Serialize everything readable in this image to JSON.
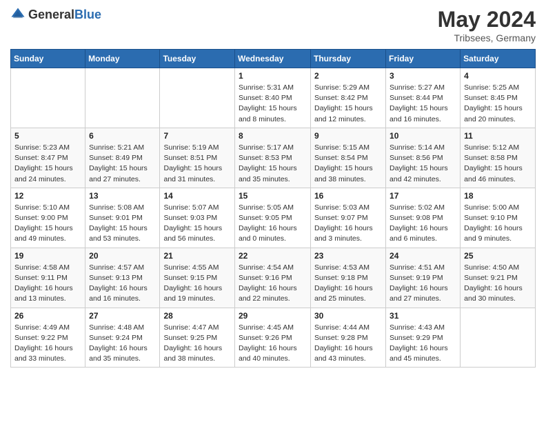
{
  "logo": {
    "general": "General",
    "blue": "Blue"
  },
  "header": {
    "title": "May 2024",
    "subtitle": "Tribsees, Germany"
  },
  "weekdays": [
    "Sunday",
    "Monday",
    "Tuesday",
    "Wednesday",
    "Thursday",
    "Friday",
    "Saturday"
  ],
  "weeks": [
    [
      {
        "day": "",
        "info": ""
      },
      {
        "day": "",
        "info": ""
      },
      {
        "day": "",
        "info": ""
      },
      {
        "day": "1",
        "info": "Sunrise: 5:31 AM\nSunset: 8:40 PM\nDaylight: 15 hours\nand 8 minutes."
      },
      {
        "day": "2",
        "info": "Sunrise: 5:29 AM\nSunset: 8:42 PM\nDaylight: 15 hours\nand 12 minutes."
      },
      {
        "day": "3",
        "info": "Sunrise: 5:27 AM\nSunset: 8:44 PM\nDaylight: 15 hours\nand 16 minutes."
      },
      {
        "day": "4",
        "info": "Sunrise: 5:25 AM\nSunset: 8:45 PM\nDaylight: 15 hours\nand 20 minutes."
      }
    ],
    [
      {
        "day": "5",
        "info": "Sunrise: 5:23 AM\nSunset: 8:47 PM\nDaylight: 15 hours\nand 24 minutes."
      },
      {
        "day": "6",
        "info": "Sunrise: 5:21 AM\nSunset: 8:49 PM\nDaylight: 15 hours\nand 27 minutes."
      },
      {
        "day": "7",
        "info": "Sunrise: 5:19 AM\nSunset: 8:51 PM\nDaylight: 15 hours\nand 31 minutes."
      },
      {
        "day": "8",
        "info": "Sunrise: 5:17 AM\nSunset: 8:53 PM\nDaylight: 15 hours\nand 35 minutes."
      },
      {
        "day": "9",
        "info": "Sunrise: 5:15 AM\nSunset: 8:54 PM\nDaylight: 15 hours\nand 38 minutes."
      },
      {
        "day": "10",
        "info": "Sunrise: 5:14 AM\nSunset: 8:56 PM\nDaylight: 15 hours\nand 42 minutes."
      },
      {
        "day": "11",
        "info": "Sunrise: 5:12 AM\nSunset: 8:58 PM\nDaylight: 15 hours\nand 46 minutes."
      }
    ],
    [
      {
        "day": "12",
        "info": "Sunrise: 5:10 AM\nSunset: 9:00 PM\nDaylight: 15 hours\nand 49 minutes."
      },
      {
        "day": "13",
        "info": "Sunrise: 5:08 AM\nSunset: 9:01 PM\nDaylight: 15 hours\nand 53 minutes."
      },
      {
        "day": "14",
        "info": "Sunrise: 5:07 AM\nSunset: 9:03 PM\nDaylight: 15 hours\nand 56 minutes."
      },
      {
        "day": "15",
        "info": "Sunrise: 5:05 AM\nSunset: 9:05 PM\nDaylight: 16 hours\nand 0 minutes."
      },
      {
        "day": "16",
        "info": "Sunrise: 5:03 AM\nSunset: 9:07 PM\nDaylight: 16 hours\nand 3 minutes."
      },
      {
        "day": "17",
        "info": "Sunrise: 5:02 AM\nSunset: 9:08 PM\nDaylight: 16 hours\nand 6 minutes."
      },
      {
        "day": "18",
        "info": "Sunrise: 5:00 AM\nSunset: 9:10 PM\nDaylight: 16 hours\nand 9 minutes."
      }
    ],
    [
      {
        "day": "19",
        "info": "Sunrise: 4:58 AM\nSunset: 9:11 PM\nDaylight: 16 hours\nand 13 minutes."
      },
      {
        "day": "20",
        "info": "Sunrise: 4:57 AM\nSunset: 9:13 PM\nDaylight: 16 hours\nand 16 minutes."
      },
      {
        "day": "21",
        "info": "Sunrise: 4:55 AM\nSunset: 9:15 PM\nDaylight: 16 hours\nand 19 minutes."
      },
      {
        "day": "22",
        "info": "Sunrise: 4:54 AM\nSunset: 9:16 PM\nDaylight: 16 hours\nand 22 minutes."
      },
      {
        "day": "23",
        "info": "Sunrise: 4:53 AM\nSunset: 9:18 PM\nDaylight: 16 hours\nand 25 minutes."
      },
      {
        "day": "24",
        "info": "Sunrise: 4:51 AM\nSunset: 9:19 PM\nDaylight: 16 hours\nand 27 minutes."
      },
      {
        "day": "25",
        "info": "Sunrise: 4:50 AM\nSunset: 9:21 PM\nDaylight: 16 hours\nand 30 minutes."
      }
    ],
    [
      {
        "day": "26",
        "info": "Sunrise: 4:49 AM\nSunset: 9:22 PM\nDaylight: 16 hours\nand 33 minutes."
      },
      {
        "day": "27",
        "info": "Sunrise: 4:48 AM\nSunset: 9:24 PM\nDaylight: 16 hours\nand 35 minutes."
      },
      {
        "day": "28",
        "info": "Sunrise: 4:47 AM\nSunset: 9:25 PM\nDaylight: 16 hours\nand 38 minutes."
      },
      {
        "day": "29",
        "info": "Sunrise: 4:45 AM\nSunset: 9:26 PM\nDaylight: 16 hours\nand 40 minutes."
      },
      {
        "day": "30",
        "info": "Sunrise: 4:44 AM\nSunset: 9:28 PM\nDaylight: 16 hours\nand 43 minutes."
      },
      {
        "day": "31",
        "info": "Sunrise: 4:43 AM\nSunset: 9:29 PM\nDaylight: 16 hours\nand 45 minutes."
      },
      {
        "day": "",
        "info": ""
      }
    ]
  ]
}
